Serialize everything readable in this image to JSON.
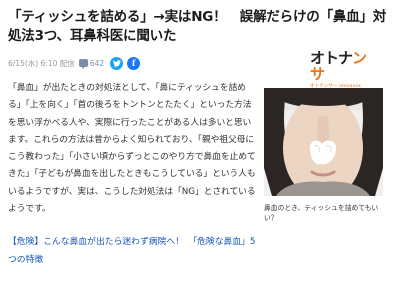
{
  "article": {
    "headline": "「ティッシュを詰める」→実はNG！　誤解だらけの「鼻血」対処法3つ、耳鼻科医に聞いた",
    "date": "6/15(水) 6:10 配信",
    "comment_count": "642",
    "share": {
      "twitter": "t",
      "facebook": "f"
    },
    "body": "「鼻血」が出たときの対処法として、「鼻にティッシュを詰める」「上を向く」「首の後ろをトントンとたたく」といった方法を思い浮かべる人や、実際に行ったことがある人は多いと思います。これらの方法は昔からよく知られており、「親や祖父母にこう教わった」「小さい頃からずっとこのやり方で鼻血を止めてきた」「子どもが鼻血を出したときもこうしている」という人もいるようですが、実は、こうした対処法は「NG」とされているようです。",
    "related": "【危険】こんな鼻血が出たら迷わず病院へ！　「危険な鼻血」5つの特徴"
  },
  "logo": {
    "mark_a": "オトナ",
    "mark_b": "ンサ",
    "sub": "オトナンサー otonansa"
  },
  "photo": {
    "caption": "鼻血のとき、ティッシュを詰めてもいい？"
  },
  "colors": {
    "link": "#1756b8",
    "twitter": "#1da1f2",
    "facebook": "#1877f2",
    "brand": "#e8751a"
  }
}
